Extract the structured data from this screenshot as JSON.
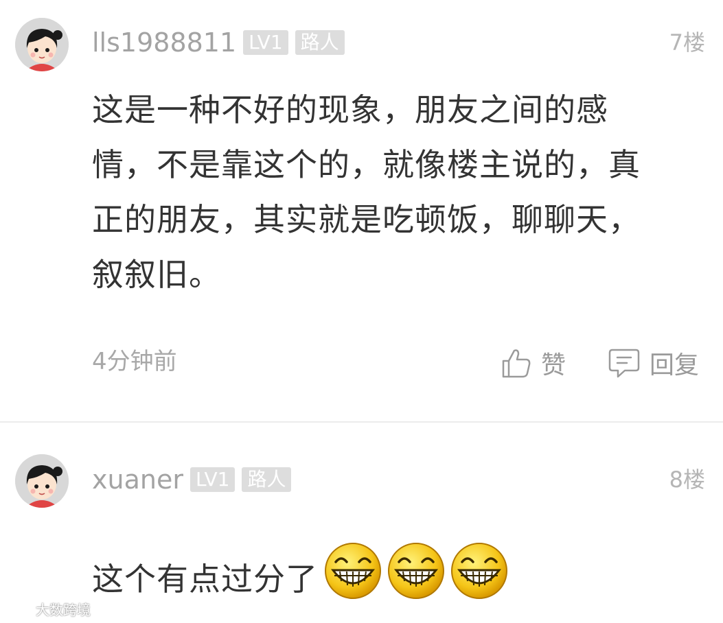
{
  "comments": [
    {
      "username": "lls1988811",
      "level_badge": "LV1",
      "rank_badge": "路人",
      "floor": "7楼",
      "content": "这是一种不好的现象，朋友之间的感情，不是靠这个的，就像楼主说的，真正的朋友，其实就是吃顿饭，聊聊天，叙叙旧。",
      "time": "4分钟前",
      "like_label": "赞",
      "reply_label": "回复"
    },
    {
      "username": "xuaner",
      "level_badge": "LV1",
      "rank_badge": "路人",
      "floor": "8楼",
      "content": "这个有点过分了",
      "emoji_count": 3
    }
  ],
  "watermark": "大数跨境",
  "icons": {
    "avatar": "default-avatar-girl-icon",
    "like": "thumbs-up-icon",
    "reply": "comment-bubble-icon",
    "emoji": "big-grin-emoji-icon"
  }
}
